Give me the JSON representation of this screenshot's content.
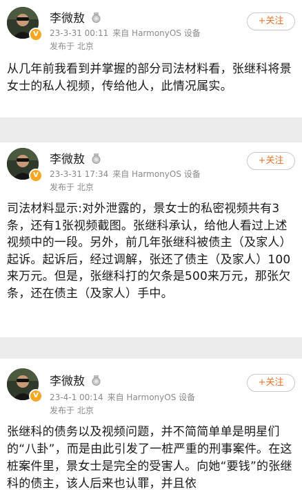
{
  "posts": [
    {
      "author": "李微敖",
      "time": "23-3-31 00:11",
      "source": "来自 HarmonyOS 设备",
      "location": "发布于 北京",
      "follow_label": "+关注",
      "body": "从几年前我看到并掌握的部分司法材料看，张继科将景女士的私人视频，传给他人，此情况属实。"
    },
    {
      "author": "李微敖",
      "time": "23-3-31 17:34",
      "source": "来自 HarmonyOS 设备",
      "location": "发布于 北京",
      "follow_label": "+关注",
      "body": "司法材料显示:对外泄露的，景女士的私密视频共有3条，还有1张视频截图。张继科承认，给他人看过上述视频中的一段。另外，前几年张继科被债主（及家人）起诉。起诉后，经过调解，张还了债主（及家人）100来万元。但是，张继科打的欠条是500来万元，那张欠条，还在债主（及家人）手中。"
    },
    {
      "author": "李微敖",
      "time": "23-4-1 00:14",
      "source": "来自 HarmonyOS 设备",
      "location": "发布于 北京",
      "follow_label": "+关注",
      "body": "张继科的债务以及视频问题，并不简简单单是明星们的“八卦”，而是由此引发了一桩严重的刑事案件。在这桩案件里，景女士是完全的受害人。向她“要钱”的张继科的债主，该人后来也认罪，并且依"
    }
  ],
  "colors": {
    "follow_text": "#e8722a",
    "verified_badge": "#f5a623",
    "meta_text": "#8a8a8a"
  },
  "icons": {
    "verified": "verified-badge-icon",
    "medal": "medal-icon"
  }
}
